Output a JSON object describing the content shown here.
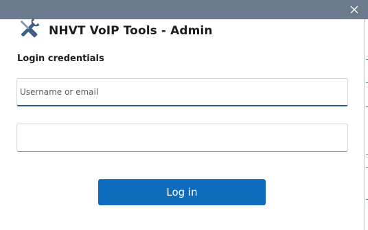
{
  "window": {
    "close_icon": "close-icon",
    "titlebar_color": "#6b7b8d"
  },
  "header": {
    "icon": "tools-icon",
    "title": "NHVT VoIP Tools - Admin"
  },
  "form": {
    "section_label": "Login credentials",
    "username": {
      "value": "",
      "placeholder": "Username or email"
    },
    "password": {
      "value": "",
      "placeholder": ""
    },
    "submit_label": "Log in"
  },
  "colors": {
    "accent": "#0f6cbd",
    "focus_underline": "#2a5a9a"
  }
}
